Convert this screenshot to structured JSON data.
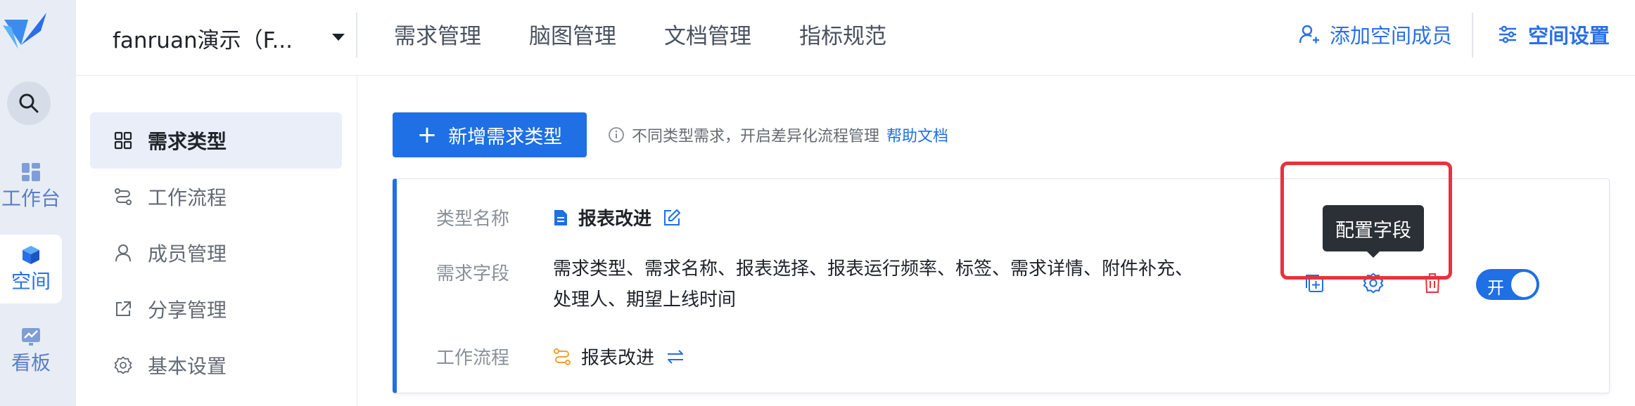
{
  "rail": {
    "items": [
      {
        "label": "工作台",
        "icon": "dashboard-icon"
      },
      {
        "label": "空间",
        "icon": "cube-icon"
      },
      {
        "label": "看板",
        "icon": "chart-board-icon"
      }
    ]
  },
  "topbar": {
    "space_name": "fanruan演示（F...",
    "tabs": [
      "需求管理",
      "脑图管理",
      "文档管理",
      "指标规范"
    ],
    "add_member": "添加空间成员",
    "space_settings": "空间设置"
  },
  "leftmenu": {
    "items": [
      "需求类型",
      "工作流程",
      "成员管理",
      "分享管理",
      "基本设置"
    ]
  },
  "main": {
    "add_button": "新增需求类型",
    "hint": "不同类型需求，开启差异化流程管理",
    "help_link": "帮助文档",
    "card": {
      "type_label": "类型名称",
      "type_name": "报表改进",
      "fields_label": "需求字段",
      "fields_line1": "需求类型、需求名称、报表选择、报表运行频率、标签、需求详情、附件补充、",
      "fields_line2": "处理人、期望上线时间",
      "flow_label": "工作流程",
      "flow_name": "报表改进",
      "toggle": "开"
    },
    "tooltip": "配置字段"
  },
  "colors": {
    "accent": "#1f6fe5",
    "highlight": "#e8323c",
    "flow_icon": "#f0a030"
  }
}
